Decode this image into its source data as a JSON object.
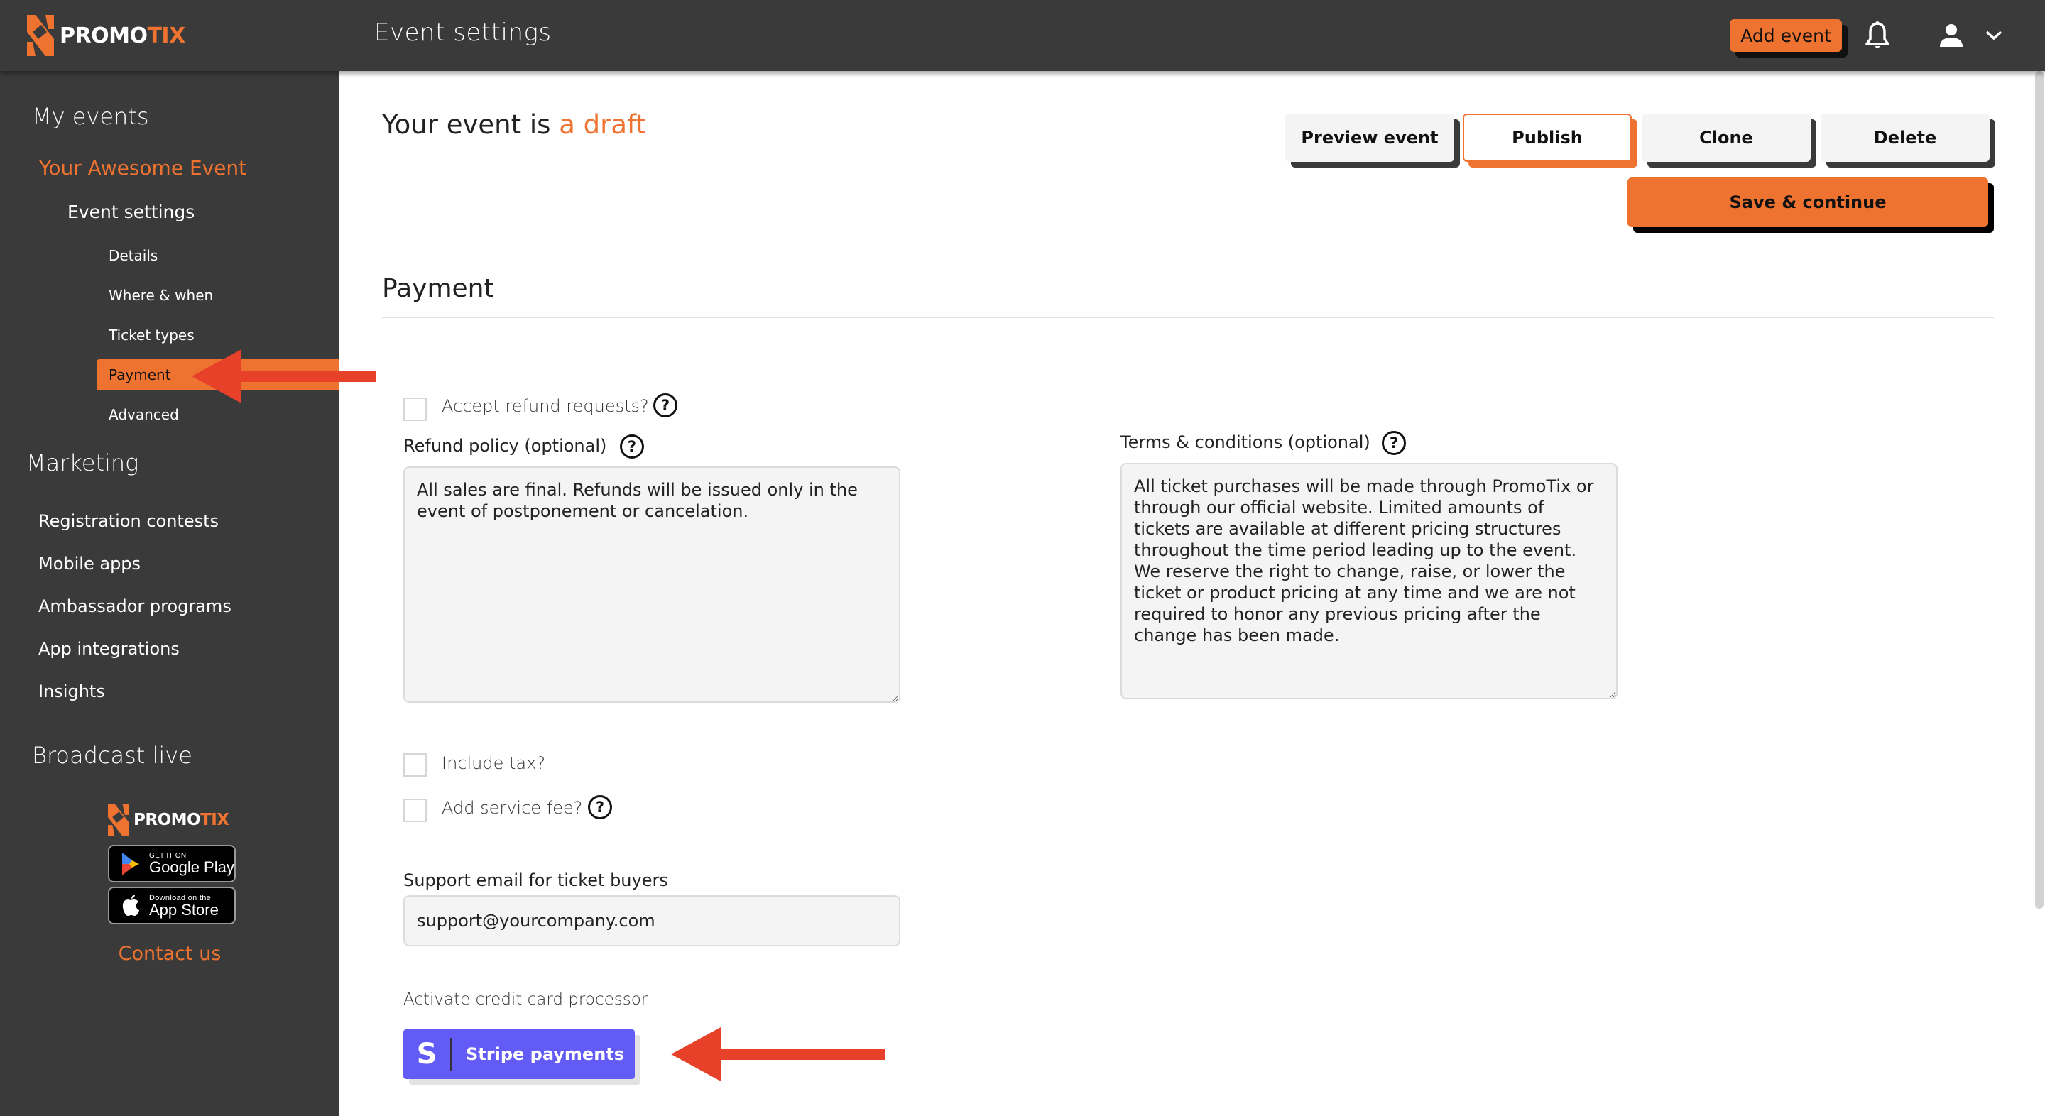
{
  "app": {
    "brand": {
      "name_main": "PROMO",
      "name_accent": "TIX"
    },
    "page_title": "Event settings",
    "add_event_label": "Add event",
    "icons": {
      "notifications": "bell-icon",
      "account": "user-icon",
      "menu": "chevron-down-icon"
    }
  },
  "sidebar": {
    "my_events": "My events",
    "event_name": "Your Awesome Event",
    "event_settings": "Event settings",
    "settings_items": [
      {
        "label": "Details",
        "active": false
      },
      {
        "label": "Where & when",
        "active": false
      },
      {
        "label": "Ticket types",
        "active": false
      },
      {
        "label": "Payment",
        "active": true
      },
      {
        "label": "Advanced",
        "active": false
      }
    ],
    "marketing": "Marketing",
    "marketing_items": [
      {
        "label": "Registration contests"
      },
      {
        "label": "Mobile apps"
      },
      {
        "label": "Ambassador programs"
      },
      {
        "label": "App integrations"
      },
      {
        "label": "Insights"
      }
    ],
    "broadcast": "Broadcast live",
    "google_play": {
      "small": "GET IT ON",
      "big": "Google Play"
    },
    "app_store": {
      "small": "Download on the",
      "big": "App Store"
    },
    "contact": "Contact us"
  },
  "header": {
    "status_prefix": "Your event is",
    "status_value": "a draft",
    "actions": {
      "preview": "Preview event",
      "publish": "Publish",
      "clone": "Clone",
      "delete": "Delete",
      "save": "Save & continue"
    }
  },
  "payment": {
    "section_title": "Payment",
    "accept_refunds": {
      "label": "Accept refund requests?",
      "checked": false
    },
    "refund_policy": {
      "label": "Refund policy (optional)",
      "value": "All sales are final. Refunds will be issued only in the event of postponement or cancelation."
    },
    "terms": {
      "label": "Terms & conditions (optional)",
      "value": "All ticket purchases will be made through PromoTix or through our official website. Limited amounts of tickets are available at different pricing structures throughout the time period leading up to the event. We reserve the right to change, raise, or lower the ticket or product pricing at any time and we are not required to honor any previous pricing after the change has been made."
    },
    "include_tax": {
      "label": "Include tax?",
      "checked": false
    },
    "service_fee": {
      "label": "Add service fee?",
      "checked": false
    },
    "support_email": {
      "label": "Support email for ticket buyers",
      "value": "support@yourcompany.com"
    },
    "processor_label": "Activate credit card processor",
    "stripe": {
      "letter": "S",
      "label": "Stripe payments"
    },
    "help_glyph": "?"
  },
  "colors": {
    "accent": "#ee7330",
    "dark": "#3a3a3a",
    "stripe": "#635bf6",
    "annotation_arrow": "#e8412a"
  }
}
